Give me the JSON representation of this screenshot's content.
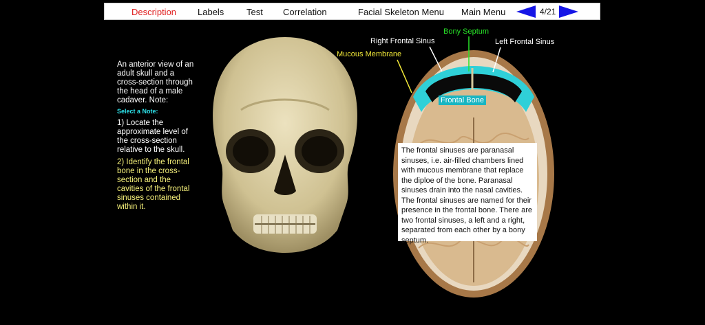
{
  "nav": {
    "items": [
      {
        "label": "Description",
        "active": true
      },
      {
        "label": "Labels",
        "active": false
      },
      {
        "label": "Test",
        "active": false
      },
      {
        "label": "Correlation",
        "active": false
      },
      {
        "label": "Facial Skeleton Menu",
        "active": false
      },
      {
        "label": "Main Menu",
        "active": false
      }
    ],
    "page_indicator": "4/21",
    "prev_icon": "left-arrow-icon",
    "next_icon": "right-arrow-icon",
    "arrow_color": "#1515e6",
    "active_color": "#e02020"
  },
  "description": {
    "intro": "An anterior view of an adult skull and a cross-section through the head of a male cadaver. Note:",
    "select_note": "Select a Note:",
    "note1": "1) Locate the approximate level of the cross-section relative to the skull.",
    "note2": "2) Identify the frontal bone in the cross-section and the cavities of the frontal sinuses contained within it."
  },
  "labels": {
    "right_frontal_sinus": "Right Frontal Sinus",
    "bony_septum": "Bony Septum",
    "left_frontal_sinus": "Left Frontal Sinus",
    "mucous_membrane": "Mucous Membrane",
    "frontal_bone": "Frontal Bone"
  },
  "info_text": "The frontal sinuses are paranasal sinuses, i.e. air-filled chambers lined with mucous membrane that replace the diploe of the bone. Paranasal sinuses drain into the nasal cavities. The frontal sinuses are named for their presence in the frontal bone. There are two frontal sinuses, a left and a right, separated from each other by a bony septum."
}
